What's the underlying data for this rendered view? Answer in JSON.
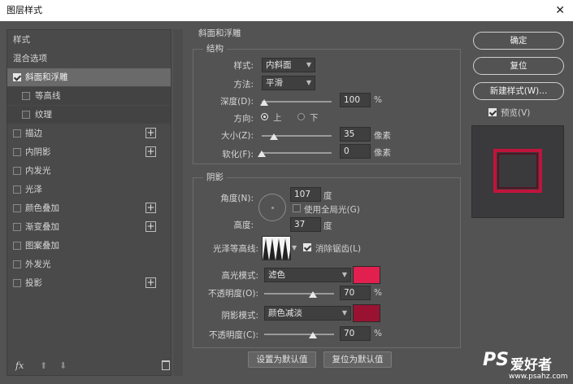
{
  "window": {
    "title": "图层样式",
    "close_glyph": "✕"
  },
  "left_panel": {
    "header": "样式",
    "blend_options": "混合选项",
    "items": [
      {
        "label": "斜面和浮雕",
        "checked": true,
        "selected": true,
        "has_plus": false,
        "sub": false
      },
      {
        "label": "等高线",
        "checked": false,
        "selected": false,
        "has_plus": false,
        "sub": true
      },
      {
        "label": "纹理",
        "checked": false,
        "selected": false,
        "has_plus": false,
        "sub": true
      },
      {
        "label": "描边",
        "checked": false,
        "has_plus": true
      },
      {
        "label": "内阴影",
        "checked": false,
        "has_plus": true
      },
      {
        "label": "内发光",
        "checked": false,
        "has_plus": false
      },
      {
        "label": "光泽",
        "checked": false,
        "has_plus": false
      },
      {
        "label": "颜色叠加",
        "checked": false,
        "has_plus": true
      },
      {
        "label": "渐变叠加",
        "checked": false,
        "has_plus": true
      },
      {
        "label": "图案叠加",
        "checked": false,
        "has_plus": false
      },
      {
        "label": "外发光",
        "checked": false,
        "has_plus": false
      },
      {
        "label": "投影",
        "checked": false,
        "has_plus": true
      }
    ],
    "fx_label": "fx",
    "plus_glyph": "+",
    "up_glyph": "⬆",
    "down_glyph": "⬇"
  },
  "bevel": {
    "section_title": "斜面和浮雕",
    "structure": {
      "title": "结构",
      "style_label": "样式:",
      "style_value": "内斜面",
      "technique_label": "方法:",
      "technique_value": "平滑",
      "depth_label": "深度(D):",
      "depth_value": "100",
      "depth_unit": "%",
      "direction_label": "方向:",
      "direction_up": "上",
      "direction_down": "下",
      "direction_selected": "上",
      "size_label": "大小(Z):",
      "size_value": "35",
      "size_unit": "像素",
      "soften_label": "软化(F):",
      "soften_value": "0",
      "soften_unit": "像素"
    },
    "shading": {
      "title": "阴影",
      "angle_label": "角度(N):",
      "angle_value": "107",
      "angle_unit": "度",
      "global_light_label": "使用全局光(G)",
      "global_light_checked": false,
      "altitude_label": "高度:",
      "altitude_value": "37",
      "altitude_unit": "度",
      "gloss_contour_label": "光泽等高线:",
      "anti_alias_label": "消除锯齿(L)",
      "anti_alias_checked": true,
      "highlight_mode_label": "高光模式:",
      "highlight_mode_value": "滤色",
      "highlight_color": "#e2204f",
      "highlight_opacity_label": "不透明度(O):",
      "highlight_opacity_value": "70",
      "highlight_opacity_unit": "%",
      "shadow_mode_label": "阴影模式:",
      "shadow_mode_value": "颜色减淡",
      "shadow_color": "#9a1232",
      "shadow_opacity_label": "不透明度(C):",
      "shadow_opacity_value": "70",
      "shadow_opacity_unit": "%"
    },
    "make_default": "设置为默认值",
    "reset_default": "复位为默认值",
    "slider_levels": {
      "depth": 0.03,
      "size": 0.17,
      "soften": 0.0,
      "highlight_opacity": 0.7,
      "shadow_opacity": 0.7
    }
  },
  "right": {
    "ok": "确定",
    "reset": "复位",
    "new_style": "新建样式(W)...",
    "preview_label": "预览(V)",
    "preview_checked": true,
    "preview_frame_color": "#c0143c"
  },
  "watermark": {
    "logo": "PS",
    "text": "爱好者",
    "url": "www.psahz.com"
  },
  "colors": {
    "dialog_bg": "#535353",
    "selected_item": "#6a6a6a"
  }
}
